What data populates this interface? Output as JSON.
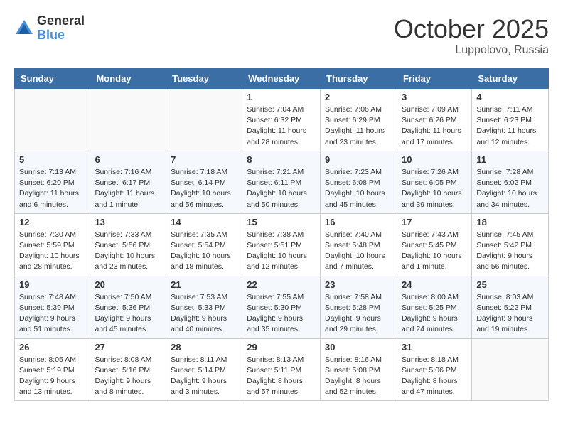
{
  "header": {
    "logo_general": "General",
    "logo_blue": "Blue",
    "title": "October 2025",
    "location": "Luppolovo, Russia"
  },
  "weekdays": [
    "Sunday",
    "Monday",
    "Tuesday",
    "Wednesday",
    "Thursday",
    "Friday",
    "Saturday"
  ],
  "weeks": [
    [
      {
        "day": "",
        "content": ""
      },
      {
        "day": "",
        "content": ""
      },
      {
        "day": "",
        "content": ""
      },
      {
        "day": "1",
        "content": "Sunrise: 7:04 AM\nSunset: 6:32 PM\nDaylight: 11 hours\nand 28 minutes."
      },
      {
        "day": "2",
        "content": "Sunrise: 7:06 AM\nSunset: 6:29 PM\nDaylight: 11 hours\nand 23 minutes."
      },
      {
        "day": "3",
        "content": "Sunrise: 7:09 AM\nSunset: 6:26 PM\nDaylight: 11 hours\nand 17 minutes."
      },
      {
        "day": "4",
        "content": "Sunrise: 7:11 AM\nSunset: 6:23 PM\nDaylight: 11 hours\nand 12 minutes."
      }
    ],
    [
      {
        "day": "5",
        "content": "Sunrise: 7:13 AM\nSunset: 6:20 PM\nDaylight: 11 hours\nand 6 minutes."
      },
      {
        "day": "6",
        "content": "Sunrise: 7:16 AM\nSunset: 6:17 PM\nDaylight: 11 hours\nand 1 minute."
      },
      {
        "day": "7",
        "content": "Sunrise: 7:18 AM\nSunset: 6:14 PM\nDaylight: 10 hours\nand 56 minutes."
      },
      {
        "day": "8",
        "content": "Sunrise: 7:21 AM\nSunset: 6:11 PM\nDaylight: 10 hours\nand 50 minutes."
      },
      {
        "day": "9",
        "content": "Sunrise: 7:23 AM\nSunset: 6:08 PM\nDaylight: 10 hours\nand 45 minutes."
      },
      {
        "day": "10",
        "content": "Sunrise: 7:26 AM\nSunset: 6:05 PM\nDaylight: 10 hours\nand 39 minutes."
      },
      {
        "day": "11",
        "content": "Sunrise: 7:28 AM\nSunset: 6:02 PM\nDaylight: 10 hours\nand 34 minutes."
      }
    ],
    [
      {
        "day": "12",
        "content": "Sunrise: 7:30 AM\nSunset: 5:59 PM\nDaylight: 10 hours\nand 28 minutes."
      },
      {
        "day": "13",
        "content": "Sunrise: 7:33 AM\nSunset: 5:56 PM\nDaylight: 10 hours\nand 23 minutes."
      },
      {
        "day": "14",
        "content": "Sunrise: 7:35 AM\nSunset: 5:54 PM\nDaylight: 10 hours\nand 18 minutes."
      },
      {
        "day": "15",
        "content": "Sunrise: 7:38 AM\nSunset: 5:51 PM\nDaylight: 10 hours\nand 12 minutes."
      },
      {
        "day": "16",
        "content": "Sunrise: 7:40 AM\nSunset: 5:48 PM\nDaylight: 10 hours\nand 7 minutes."
      },
      {
        "day": "17",
        "content": "Sunrise: 7:43 AM\nSunset: 5:45 PM\nDaylight: 10 hours\nand 1 minute."
      },
      {
        "day": "18",
        "content": "Sunrise: 7:45 AM\nSunset: 5:42 PM\nDaylight: 9 hours\nand 56 minutes."
      }
    ],
    [
      {
        "day": "19",
        "content": "Sunrise: 7:48 AM\nSunset: 5:39 PM\nDaylight: 9 hours\nand 51 minutes."
      },
      {
        "day": "20",
        "content": "Sunrise: 7:50 AM\nSunset: 5:36 PM\nDaylight: 9 hours\nand 45 minutes."
      },
      {
        "day": "21",
        "content": "Sunrise: 7:53 AM\nSunset: 5:33 PM\nDaylight: 9 hours\nand 40 minutes."
      },
      {
        "day": "22",
        "content": "Sunrise: 7:55 AM\nSunset: 5:30 PM\nDaylight: 9 hours\nand 35 minutes."
      },
      {
        "day": "23",
        "content": "Sunrise: 7:58 AM\nSunset: 5:28 PM\nDaylight: 9 hours\nand 29 minutes."
      },
      {
        "day": "24",
        "content": "Sunrise: 8:00 AM\nSunset: 5:25 PM\nDaylight: 9 hours\nand 24 minutes."
      },
      {
        "day": "25",
        "content": "Sunrise: 8:03 AM\nSunset: 5:22 PM\nDaylight: 9 hours\nand 19 minutes."
      }
    ],
    [
      {
        "day": "26",
        "content": "Sunrise: 8:05 AM\nSunset: 5:19 PM\nDaylight: 9 hours\nand 13 minutes."
      },
      {
        "day": "27",
        "content": "Sunrise: 8:08 AM\nSunset: 5:16 PM\nDaylight: 9 hours\nand 8 minutes."
      },
      {
        "day": "28",
        "content": "Sunrise: 8:11 AM\nSunset: 5:14 PM\nDaylight: 9 hours\nand 3 minutes."
      },
      {
        "day": "29",
        "content": "Sunrise: 8:13 AM\nSunset: 5:11 PM\nDaylight: 8 hours\nand 57 minutes."
      },
      {
        "day": "30",
        "content": "Sunrise: 8:16 AM\nSunset: 5:08 PM\nDaylight: 8 hours\nand 52 minutes."
      },
      {
        "day": "31",
        "content": "Sunrise: 8:18 AM\nSunset: 5:06 PM\nDaylight: 8 hours\nand 47 minutes."
      },
      {
        "day": "",
        "content": ""
      }
    ]
  ]
}
